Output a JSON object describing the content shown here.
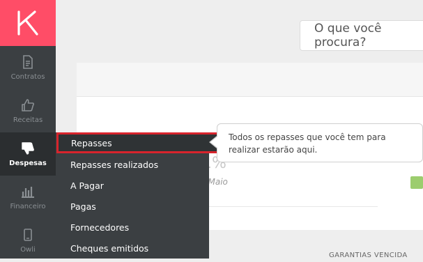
{
  "sidebar": {
    "logo_icon": "k-logo-icon",
    "items": [
      {
        "label": "Contratos",
        "icon": "document-icon"
      },
      {
        "label": "Receitas",
        "icon": "thumbs-up-icon"
      },
      {
        "label": "Despesas",
        "icon": "thumbs-down-icon",
        "active": true
      },
      {
        "label": "Financeiro",
        "icon": "bar-chart-icon"
      },
      {
        "label": "Owli",
        "icon": "phone-icon"
      }
    ]
  },
  "search": {
    "placeholder": "O que você procura?"
  },
  "flyout": {
    "items": [
      {
        "label": "Repasses"
      },
      {
        "label": "Repasses realizados"
      },
      {
        "label": "A Pagar"
      },
      {
        "label": "Pagas"
      },
      {
        "label": "Fornecedores"
      },
      {
        "label": "Cheques emitidos"
      }
    ]
  },
  "tooltip": {
    "text": "Todos os repasses que você tem para realizar estarão aqui."
  },
  "main": {
    "stat_value": "1%",
    "stat_caption": "m Maio",
    "section_heading": "GARANTIAS VENCIDA"
  },
  "colors": {
    "brand": "#ff4d67",
    "sidebar": "#3b3f42",
    "highlight": "#d8242c",
    "success": "#9ccd6e"
  }
}
